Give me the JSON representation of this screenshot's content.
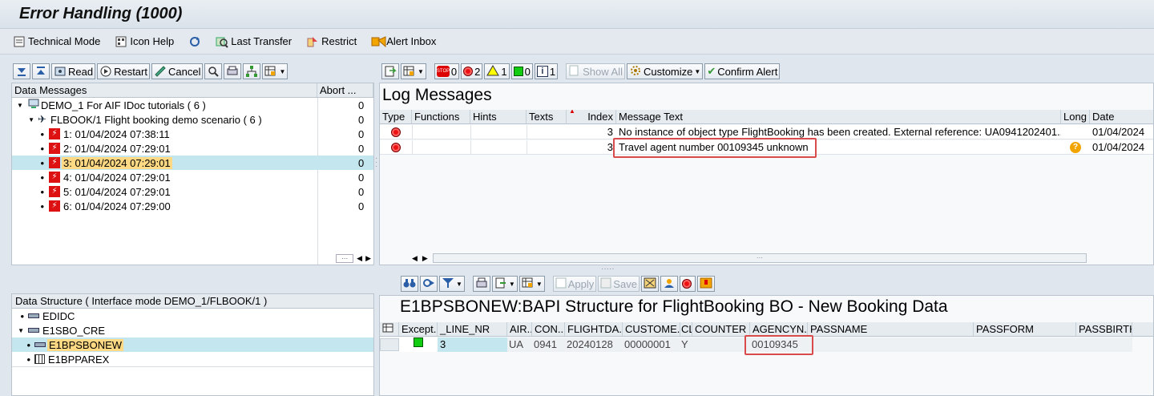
{
  "title": "Error Handling (1000)",
  "appbar": {
    "technical_mode": "Technical Mode",
    "icon_help": "Icon Help",
    "last_transfer": "Last Transfer",
    "restrict": "Restrict",
    "alert_inbox": "Alert Inbox"
  },
  "left_toolbar": {
    "read": "Read",
    "restart": "Restart",
    "cancel": "Cancel"
  },
  "data_messages": {
    "header_col1": "Data Messages",
    "header_col2": "Abort ...",
    "root": {
      "label": "DEMO_1 For AIF IDoc tutorials ( 6  )",
      "count": "0"
    },
    "scenario": {
      "label": "FLBOOK/1 Flight booking demo scenario ( 6  )",
      "count": "0"
    },
    "items": [
      {
        "label": "1: 01/04/2024 07:38:11",
        "count": "0"
      },
      {
        "label": "2: 01/04/2024 07:29:01",
        "count": "0"
      },
      {
        "label": "3: 01/04/2024 07:29:01",
        "count": "0"
      },
      {
        "label": "4: 01/04/2024 07:29:01",
        "count": "0"
      },
      {
        "label": "5: 01/04/2024 07:29:01",
        "count": "0"
      },
      {
        "label": "6: 01/04/2024 07:29:00",
        "count": "0"
      }
    ]
  },
  "log_toolbar": {
    "stop_count": "0",
    "error_count": "2",
    "warning_count": "1",
    "success_count": "0",
    "info_count": "1",
    "show_all": "Show All",
    "customize": "Customize",
    "confirm_alert": "Confirm Alert"
  },
  "log_messages": {
    "title": "Log Messages",
    "columns": [
      "Type",
      "Functions",
      "Hints",
      "Texts",
      "Index",
      "Message Text",
      "Long",
      "Date"
    ],
    "rows": [
      {
        "index": "3",
        "text": "No instance of object type FlightBooking has been created. External reference: UA0941202401...",
        "date": "01/04/2024"
      },
      {
        "index": "3",
        "text": "Travel agent number 00109345 unknown",
        "date": "01/04/2024"
      }
    ]
  },
  "data_structure": {
    "header": "Data Structure ( Interface mode DEMO_1/FLBOOK/1 )",
    "nodes": [
      "EDIDC",
      "E1SBO_CRE",
      "E1BPSBONEW",
      "E1BPPAREX"
    ]
  },
  "detail_toolbar": {
    "apply": "Apply",
    "save": "Save"
  },
  "detail": {
    "title": "E1BPSBONEW:BAPI Structure for FlightBooking BO - New Booking Data",
    "columns": [
      "Except...",
      "_LINE_NR",
      "AIR...",
      "CON...",
      "FLIGHTDA...",
      "CUSTOME...",
      "CL",
      "COUNTER",
      "AGENCYN...",
      "PASSNAME",
      "PASSFORM",
      "PASSBIRTH"
    ],
    "row": {
      "line_nr": "3",
      "air": "UA",
      "con": "0941",
      "flightdate": "20240128",
      "customer": "00000001",
      "cl": "Y",
      "counter": "",
      "agency": "00109345",
      "passname": "",
      "passform": "",
      "passbirth": ""
    }
  },
  "colors": {
    "selected_row": "#c4e6ee",
    "highlight": "#ffd983",
    "annotation_box": "#d94a4a"
  }
}
